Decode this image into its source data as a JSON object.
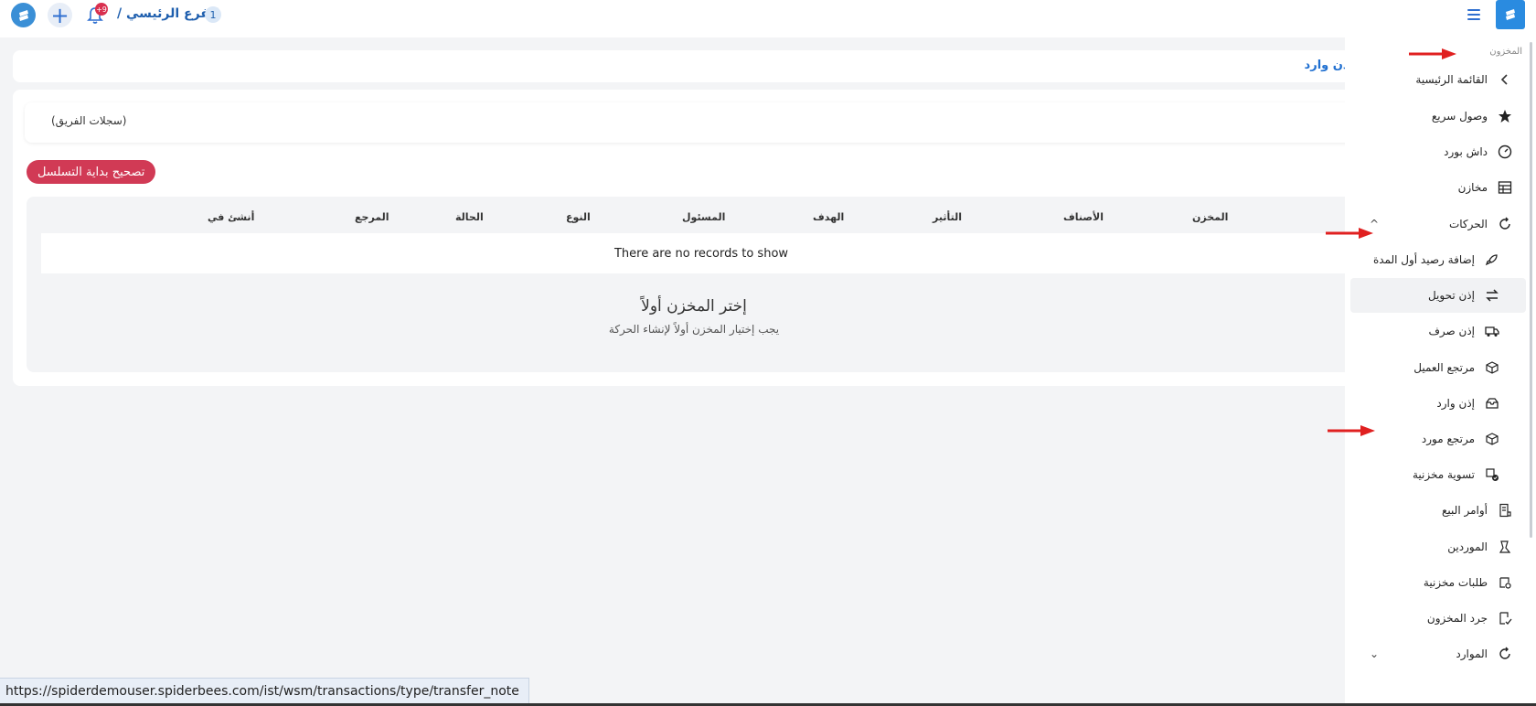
{
  "topbar": {
    "branch_label": "الفرع الرئيسي /",
    "branch_count": "1",
    "notification_badge": "+9"
  },
  "page": {
    "header_title": "إذن وارد",
    "team_records": "(سجلات الفريق)",
    "fix_sequence_button": "تصحيح بداية التسلسل",
    "table_headers": [
      "المخزن",
      "الأصناف",
      "التأثير",
      "الهدف",
      "المسئول",
      "النوع",
      "الحالة",
      "المرجع",
      "أنشئ في"
    ],
    "no_records": "There are no records to show",
    "empty_title": "إختر المخزن أولاً",
    "empty_subtitle": "يجب إختيار المخزن أولاً لإنشاء الحركة"
  },
  "sidebar": {
    "section_title": "المخزون",
    "items": [
      {
        "label": "القائمة الرئيسية",
        "icon": "chevron-left-icon"
      },
      {
        "label": "وصول سريع",
        "icon": "star-icon"
      },
      {
        "label": "داش بورد",
        "icon": "gauge-icon"
      },
      {
        "label": "مخازن",
        "icon": "warehouse-icon"
      },
      {
        "label": "الحركات",
        "icon": "refresh-icon"
      },
      {
        "label": "إضافة رصيد أول المدة",
        "icon": "rocket-icon"
      },
      {
        "label": "إذن تحويل",
        "icon": "transfer-icon"
      },
      {
        "label": "إذن صرف",
        "icon": "truck-icon"
      },
      {
        "label": "مرتجع العميل",
        "icon": "box-return-icon"
      },
      {
        "label": "إذن وارد",
        "icon": "inbox-icon"
      },
      {
        "label": "مرتجع مورد",
        "icon": "box-return-icon"
      },
      {
        "label": "تسوية مخزنية",
        "icon": "box-check-icon"
      },
      {
        "label": "أوامر البيع",
        "icon": "order-icon"
      },
      {
        "label": "الموردين",
        "icon": "supplier-icon"
      },
      {
        "label": "طلبات مخزنية",
        "icon": "request-icon"
      },
      {
        "label": "جرد المخزون",
        "icon": "stocktake-icon"
      },
      {
        "label": "الموارد",
        "icon": "refresh-icon"
      }
    ]
  },
  "statusbar": {
    "url": "https://spiderdemouser.spiderbees.com/ist/wsm/transactions/type/transfer_note"
  },
  "colors": {
    "brand_blue": "#2a8be0",
    "danger": "#d13a55",
    "arrow_red": "#e02020"
  }
}
